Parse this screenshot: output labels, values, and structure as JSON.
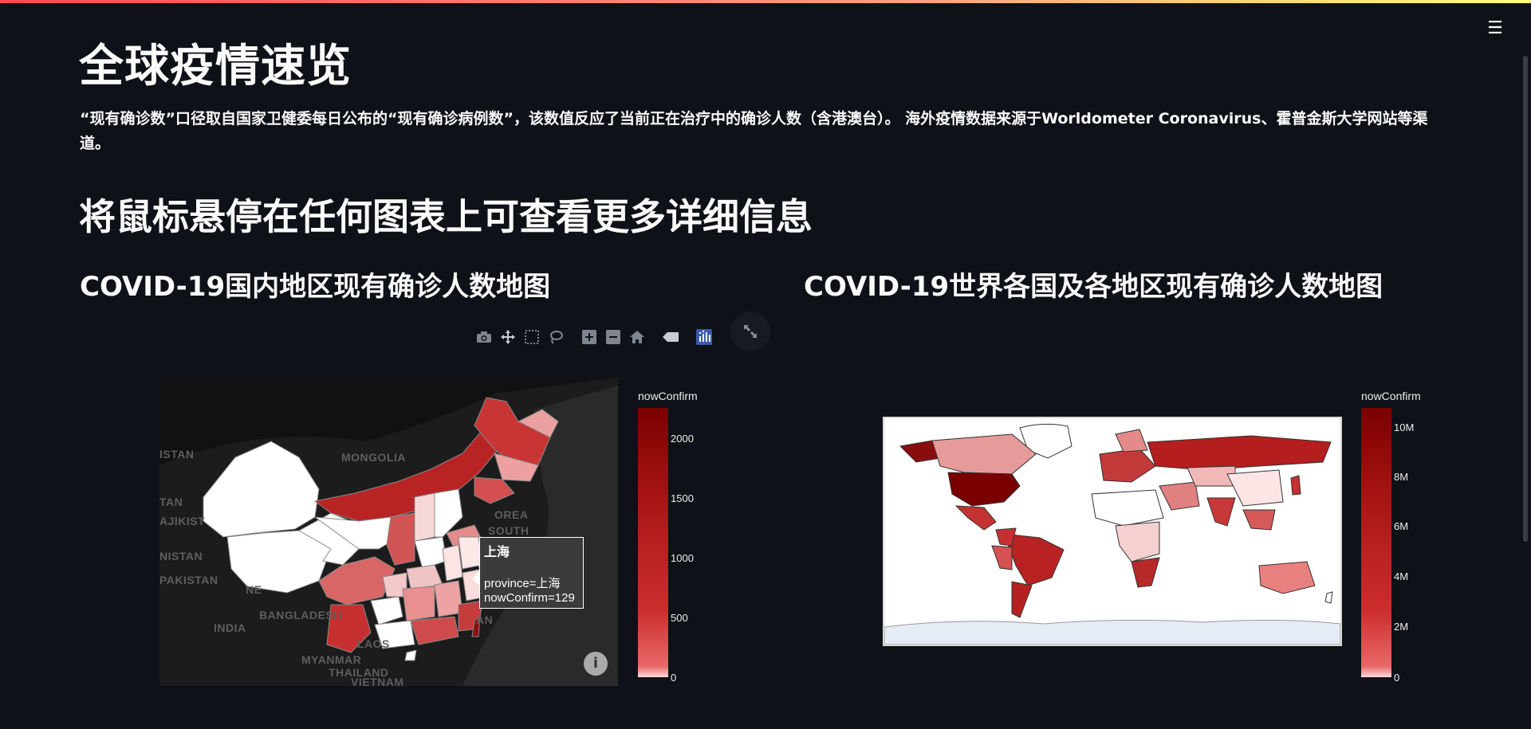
{
  "app": {
    "menu_icon": "hamburger-menu-icon",
    "menu_glyph": "☰"
  },
  "header": {
    "title": "全球疫情速览",
    "description": "“现有确诊数”口径取自国家卫健委每日公布的“现有确诊病例数”，该数值反应了当前正在治疗中的确诊人数（含港澳台）。 海外疫情数据来源于Worldometer Coronavirus、霍普金斯大学网站等渠道。",
    "hover_hint": "将鼠标悬停在任何图表上可查看更多详细信息"
  },
  "china_chart": {
    "heading": "COVID-19国内地区现有确诊人数地图",
    "map_labels": {
      "mongolia": "MONGOLIA",
      "istan_top": "ISTAN",
      "tan": "TAN",
      "ajikist": "AJIKIST",
      "nistan": "NISTAN",
      "pakistan": "PAKISTAN",
      "india": "INDIA",
      "bangladesh": "BANGLADESH",
      "laos": "LAOS",
      "myanmar": "MYANMAR",
      "thailand": "THAILAND",
      "vietnam": "VIETNAM",
      "south_korea_1": "SOUTH",
      "south_korea_2": "OREA",
      "ne": "NE",
      "an": "AN"
    },
    "tooltip": {
      "title": "上海",
      "line1": "province=上海",
      "line2": "nowConfirm=129"
    },
    "info_glyph": "i",
    "colorbar_title": "nowConfirm",
    "colorbar_ticks": [
      "2000",
      "1500",
      "1000",
      "500",
      "0"
    ]
  },
  "world_chart": {
    "heading": "COVID-19世界各国及各地区现有确诊人数地图",
    "colorbar_title": "nowConfirm",
    "colorbar_ticks": [
      "10M",
      "8M",
      "6M",
      "4M",
      "2M",
      "0"
    ]
  },
  "modebar": {
    "buttons": [
      "camera-icon",
      "pan-icon",
      "box-select-icon",
      "lasso-icon",
      "zoom-in-icon",
      "zoom-out-icon",
      "home-icon",
      "hover-label-icon",
      "plotly-logo-icon"
    ],
    "fullscreen_icon": "fullscreen-icon"
  },
  "colors": {
    "background": "#0e1117",
    "accent_stripe": [
      "#ff4b4b",
      "#fffd80"
    ],
    "choropleth_high": "#7a0000",
    "choropleth_low": "#fbdada"
  }
}
